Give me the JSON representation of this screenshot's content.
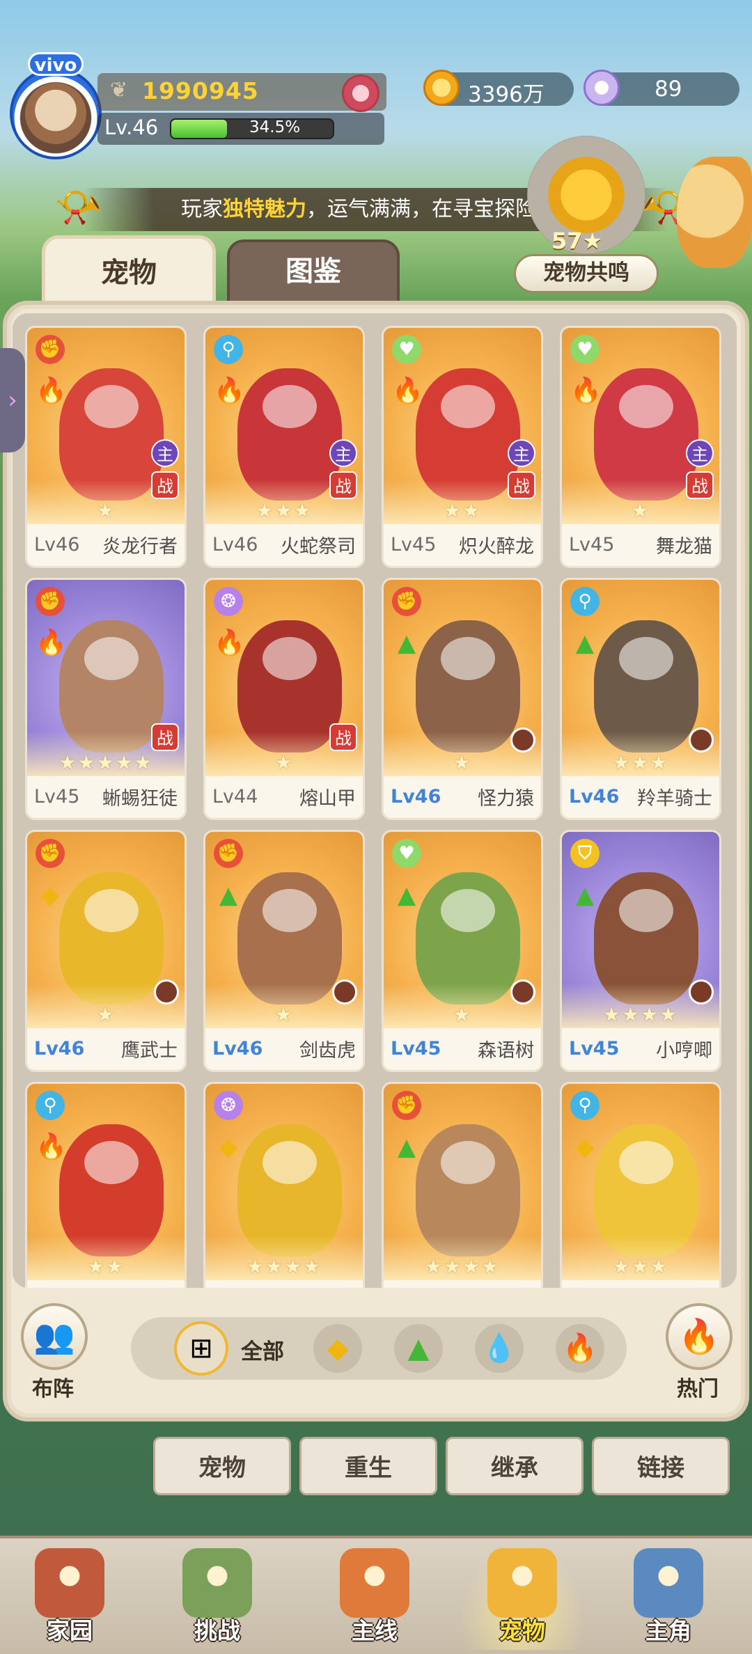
{
  "player": {
    "avatar_badge": "vivo",
    "power": "1990945",
    "level_label": "Lv.46",
    "exp_percent_text": "34.5%",
    "exp_fraction": 0.345
  },
  "currency": {
    "coins": "3396万",
    "shells": "89"
  },
  "broadcast": {
    "prefix": "玩家",
    "highlight": "独特魅力",
    "suffix": "，运气满满，在寻宝探险中，"
  },
  "resonance": {
    "value": "57",
    "label": "宠物共鸣"
  },
  "tabs": [
    {
      "label": "宠物",
      "active": true
    },
    {
      "label": "图鉴",
      "active": false
    }
  ],
  "pets": [
    {
      "level": "Lv46",
      "name": "炎龙行者",
      "role": "dps",
      "element": "fire",
      "stars": 1,
      "main": true,
      "battle": true,
      "bg": "orange",
      "level_blue": false,
      "color": "#d8453a"
    },
    {
      "level": "Lv46",
      "name": "火蛇祭司",
      "role": "mage",
      "element": "fire",
      "stars": 3,
      "main": true,
      "battle": true,
      "bg": "orange",
      "level_blue": false,
      "color": "#c9363a"
    },
    {
      "level": "Lv45",
      "name": "炽火醉龙",
      "role": "heal",
      "element": "fire",
      "stars": 2,
      "main": true,
      "battle": true,
      "bg": "orange",
      "level_blue": false,
      "color": "#d53c34"
    },
    {
      "level": "Lv45",
      "name": "舞龙猫",
      "role": "heal",
      "element": "fire",
      "stars": 1,
      "main": true,
      "battle": true,
      "bg": "orange",
      "level_blue": false,
      "color": "#cf3a44"
    },
    {
      "level": "Lv45",
      "name": "蜥蜴狂徒",
      "role": "dps",
      "element": "fire",
      "stars": 5,
      "main": false,
      "battle": true,
      "bg": "purple",
      "level_blue": false,
      "color": "#b48466"
    },
    {
      "level": "Lv44",
      "name": "熔山甲",
      "role": "spell",
      "element": "fire",
      "stars": 1,
      "main": false,
      "battle": true,
      "bg": "orange",
      "level_blue": false,
      "color": "#a8322c"
    },
    {
      "level": "Lv46",
      "name": "怪力猿",
      "role": "dps",
      "element": "earth",
      "stars": 1,
      "main": false,
      "battle": false,
      "bg": "orange",
      "level_blue": true,
      "color": "#8c6248"
    },
    {
      "level": "Lv46",
      "name": "羚羊骑士",
      "role": "mage",
      "element": "earth",
      "stars": 3,
      "main": false,
      "battle": false,
      "bg": "orange",
      "level_blue": true,
      "color": "#6e5a48"
    },
    {
      "level": "Lv46",
      "name": "鹰武士",
      "role": "dps",
      "element": "gold",
      "stars": 1,
      "main": false,
      "battle": false,
      "bg": "orange",
      "level_blue": true,
      "color": "#e8b72a"
    },
    {
      "level": "Lv46",
      "name": "剑齿虎",
      "role": "dps",
      "element": "earth",
      "stars": 1,
      "main": false,
      "battle": false,
      "bg": "orange",
      "level_blue": true,
      "color": "#a8704c"
    },
    {
      "level": "Lv45",
      "name": "森语树",
      "role": "heal",
      "element": "earth",
      "stars": 1,
      "main": false,
      "battle": false,
      "bg": "orange",
      "level_blue": true,
      "color": "#7da44a"
    },
    {
      "level": "Lv45",
      "name": "小哼唧",
      "role": "tank",
      "element": "earth",
      "stars": 4,
      "main": false,
      "battle": false,
      "bg": "purple",
      "level_blue": true,
      "color": "#8a5238"
    },
    {
      "level": "",
      "name": "",
      "role": "mage",
      "element": "fire",
      "stars": 2,
      "main": false,
      "battle": false,
      "bg": "orange",
      "level_blue": false,
      "color": "#d43c2c"
    },
    {
      "level": "",
      "name": "",
      "role": "spell",
      "element": "gold",
      "stars": 4,
      "main": false,
      "battle": false,
      "bg": "orange",
      "level_blue": false,
      "color": "#e8b62a"
    },
    {
      "level": "",
      "name": "",
      "role": "dps",
      "element": "earth",
      "stars": 4,
      "main": false,
      "battle": false,
      "bg": "orange",
      "level_blue": false,
      "color": "#b8885c"
    },
    {
      "level": "",
      "name": "",
      "role": "mage",
      "element": "gold",
      "stars": 3,
      "main": false,
      "battle": false,
      "bg": "orange",
      "level_blue": false,
      "color": "#efc43a"
    }
  ],
  "badges": {
    "main": "主",
    "battle": "战"
  },
  "filter": {
    "formation_label": "布阵",
    "all_label": "全部",
    "hot_label": "热门"
  },
  "actions": [
    {
      "label": "宠物",
      "selected": true
    },
    {
      "label": "重生",
      "selected": false
    },
    {
      "label": "继承",
      "selected": false
    },
    {
      "label": "链接",
      "selected": false
    }
  ],
  "nav": [
    {
      "label": "家园",
      "icon": "home-icon",
      "selected": false,
      "color": "#c05a3a"
    },
    {
      "label": "挑战",
      "icon": "challenge-icon",
      "selected": false,
      "color": "#7aa05a"
    },
    {
      "label": "主线",
      "icon": "mainline-icon",
      "selected": false,
      "color": "#e07a3a"
    },
    {
      "label": "宠物",
      "icon": "pet-icon",
      "selected": true,
      "color": "#f0b43a"
    },
    {
      "label": "主角",
      "icon": "hero-icon",
      "selected": false,
      "color": "#5a8ac0"
    }
  ],
  "colors": {
    "accent_yellow": "#f6c42a",
    "level_blue": "#3f84d6",
    "highlight_text": "#ffd23a"
  }
}
